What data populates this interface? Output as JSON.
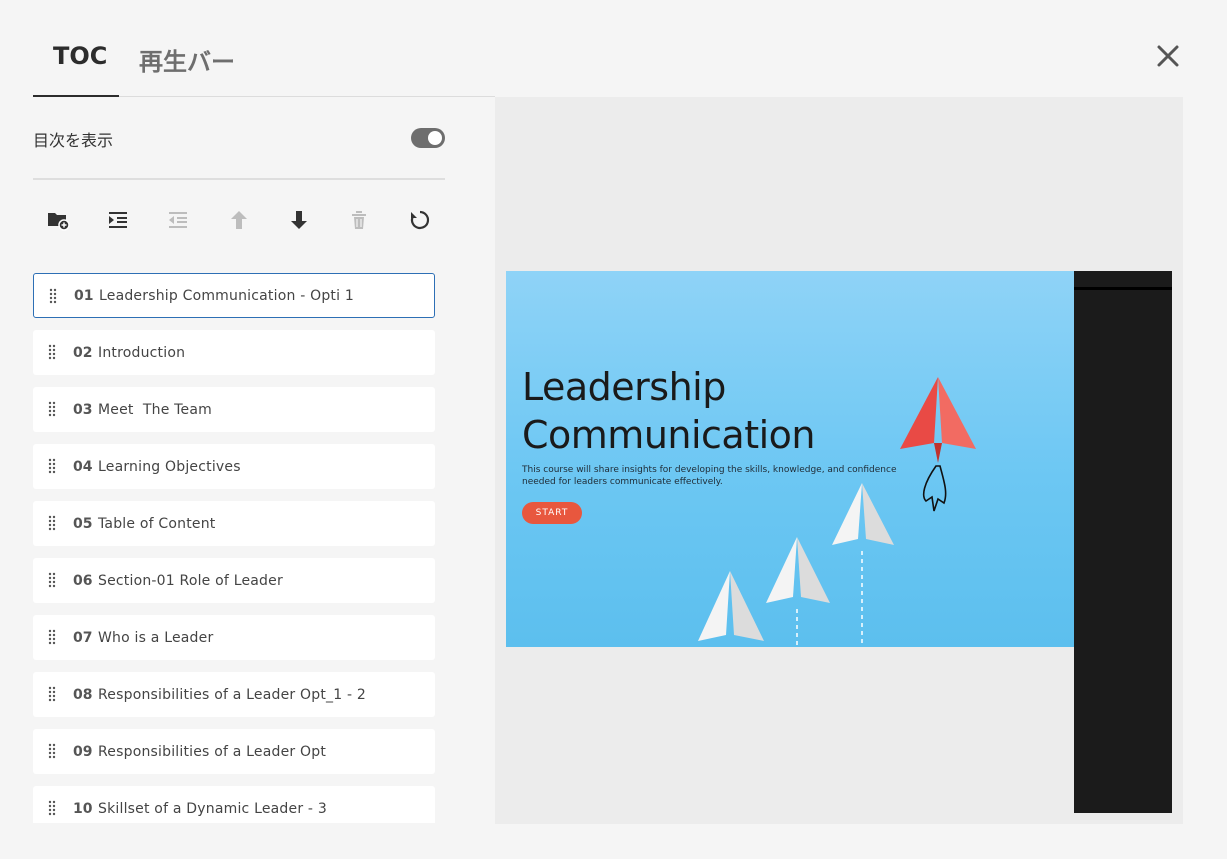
{
  "tabs": [
    {
      "label": "TOC"
    },
    {
      "label": "再生バー"
    }
  ],
  "toc_panel": {
    "show_toc_label": "目次を表示",
    "show_toc_enabled": true
  },
  "toolbar_icons": [
    "add-folder-icon",
    "indent-icon",
    "outdent-icon",
    "move-up-icon",
    "move-down-icon",
    "delete-icon",
    "reset-icon"
  ],
  "toc_items": [
    {
      "num": "01",
      "title": "Leadership Communication - Opti 1"
    },
    {
      "num": "02",
      "title": "Introduction"
    },
    {
      "num": "03",
      "title": "Meet  The Team"
    },
    {
      "num": "04",
      "title": "Learning Objectives"
    },
    {
      "num": "05",
      "title": "Table of Content"
    },
    {
      "num": "06",
      "title": "Section-01 Role of Leader"
    },
    {
      "num": "07",
      "title": "Who is a Leader"
    },
    {
      "num": "08",
      "title": "Responsibilities of a Leader Opt_1 - 2"
    },
    {
      "num": "09",
      "title": "Responsibilities of a Leader Opt"
    },
    {
      "num": "10",
      "title": "Skillset of a Dynamic Leader - 3"
    }
  ],
  "slide": {
    "title_line1": "Leadership",
    "title_line2": "Communication",
    "description": "This course will share insights for developing the skills, knowledge, and confidence needed for leaders communicate effectively.",
    "start_label": "START"
  },
  "colors": {
    "accent_start": "#e8573e",
    "selected_border": "#2d6fb5",
    "sidebar_dark": "#1b1b1b"
  }
}
